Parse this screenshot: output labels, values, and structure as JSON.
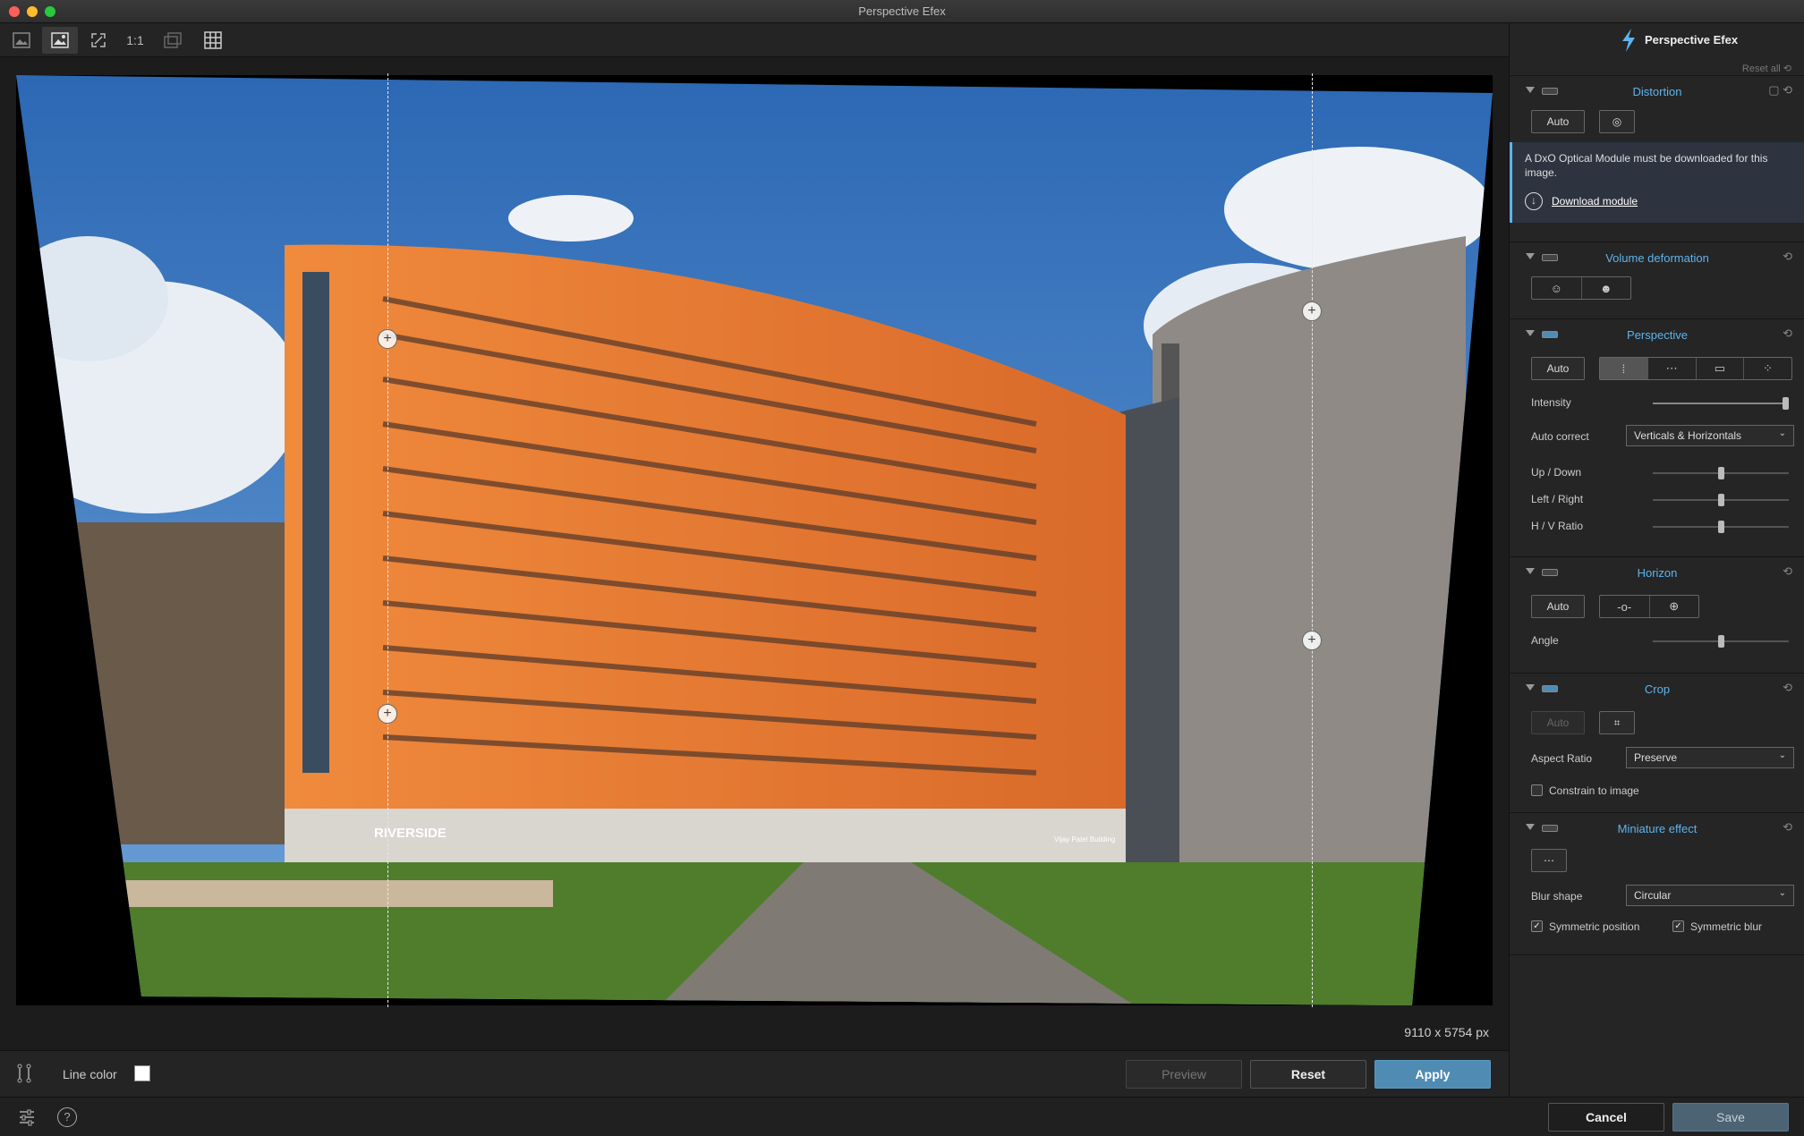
{
  "window": {
    "title": "Perspective Efex"
  },
  "traffic_colors": {
    "close": "#fe5f57",
    "minimize": "#febc2e",
    "maximize": "#28c840"
  },
  "toolbar": {
    "one_to_one": "1:1"
  },
  "brand": {
    "name": "Perspective Efex"
  },
  "sidebar": {
    "reset_all": "Reset all",
    "distortion": {
      "title": "Distortion",
      "auto": "Auto",
      "notice": "A DxO Optical Module must be downloaded for this image.",
      "download": "Download module"
    },
    "volume": {
      "title": "Volume deformation"
    },
    "perspective": {
      "title": "Perspective",
      "auto": "Auto",
      "intensity": "Intensity",
      "intensity_value": 1.0,
      "auto_correct_label": "Auto correct",
      "auto_correct_value": "Verticals & Horizontals",
      "up_down": "Up / Down",
      "up_down_value": 0.5,
      "left_right": "Left / Right",
      "left_right_value": 0.5,
      "hv_ratio": "H / V Ratio",
      "hv_ratio_value": 0.5
    },
    "horizon": {
      "title": "Horizon",
      "auto": "Auto",
      "angle": "Angle",
      "angle_value": 0.5
    },
    "crop": {
      "title": "Crop",
      "auto": "Auto",
      "aspect_label": "Aspect Ratio",
      "aspect_value": "Preserve",
      "constrain": "Constrain to image",
      "constrain_checked": false
    },
    "miniature": {
      "title": "Miniature effect",
      "blur_label": "Blur shape",
      "blur_value": "Circular",
      "sym_pos": "Symmetric position",
      "sym_pos_checked": true,
      "sym_blur": "Symmetric blur",
      "sym_blur_checked": true
    }
  },
  "image": {
    "dimensions": "9110 x 5754 px",
    "sign_text": "RIVERSIDE",
    "building_sign": "Vijay Patel Building"
  },
  "bottom": {
    "line_color": "Line color",
    "preview": "Preview",
    "reset": "Reset",
    "apply": "Apply"
  },
  "status": {
    "cancel": "Cancel",
    "save": "Save"
  },
  "colors": {
    "accent": "#5fb3ec",
    "primary_button": "#4f8bb3",
    "sky": "#3f7fc4",
    "facade": "#ec7a36",
    "grass": "#4f7d2c"
  }
}
